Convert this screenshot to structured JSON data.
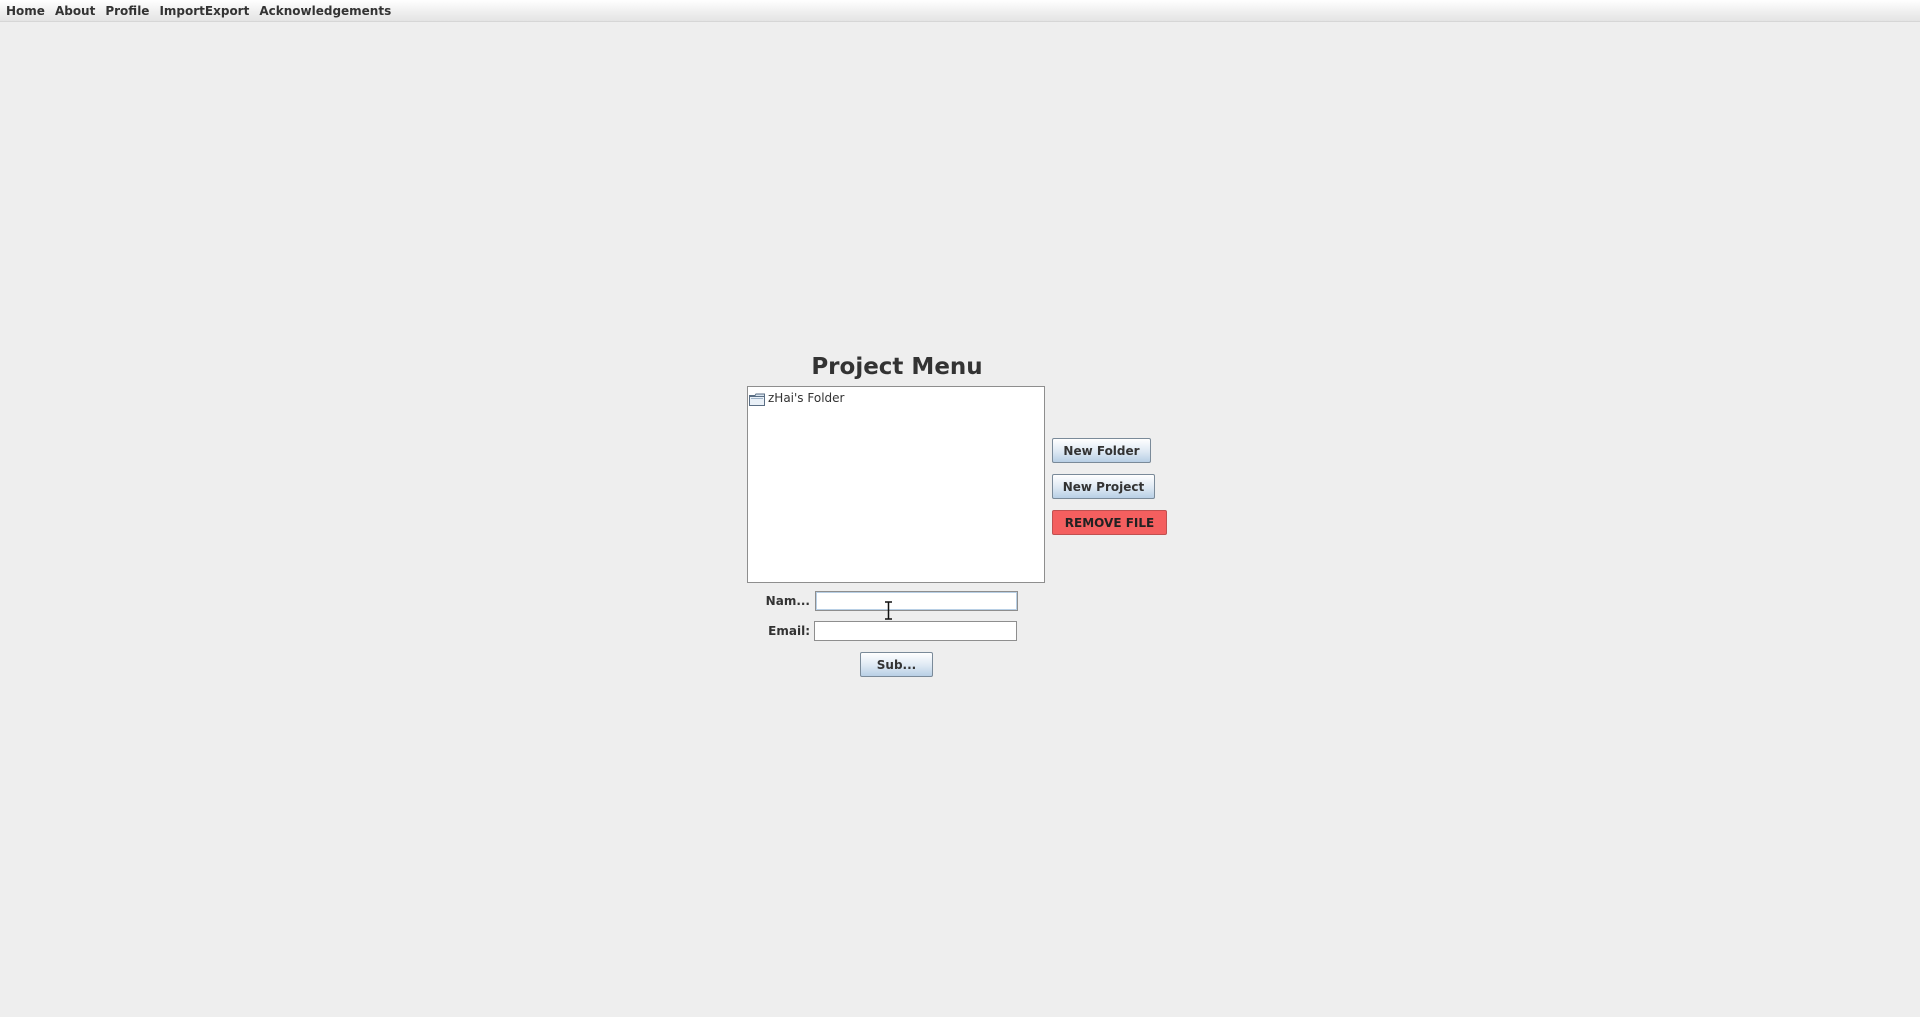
{
  "menubar": {
    "items": [
      {
        "label": "Home"
      },
      {
        "label": "About"
      },
      {
        "label": "Profile"
      },
      {
        "label": "ImportExport"
      },
      {
        "label": "Acknowledgements"
      }
    ]
  },
  "main": {
    "title": "Project Menu",
    "tree": {
      "items": [
        {
          "label": "zHai's Folder",
          "icon": "folder-icon"
        }
      ]
    },
    "buttons": {
      "new_folder": "New Folder",
      "new_project": "New Project",
      "remove_file": "REMOVE FILE"
    },
    "form": {
      "name_label": "Nam...",
      "name_value": "",
      "email_label": "Email:",
      "email_value": "",
      "submit_label": "Sub..."
    }
  },
  "colors": {
    "background": "#eeeeee",
    "danger": "#f45f5f",
    "button_gradient_bottom": "#b8cfe5"
  }
}
